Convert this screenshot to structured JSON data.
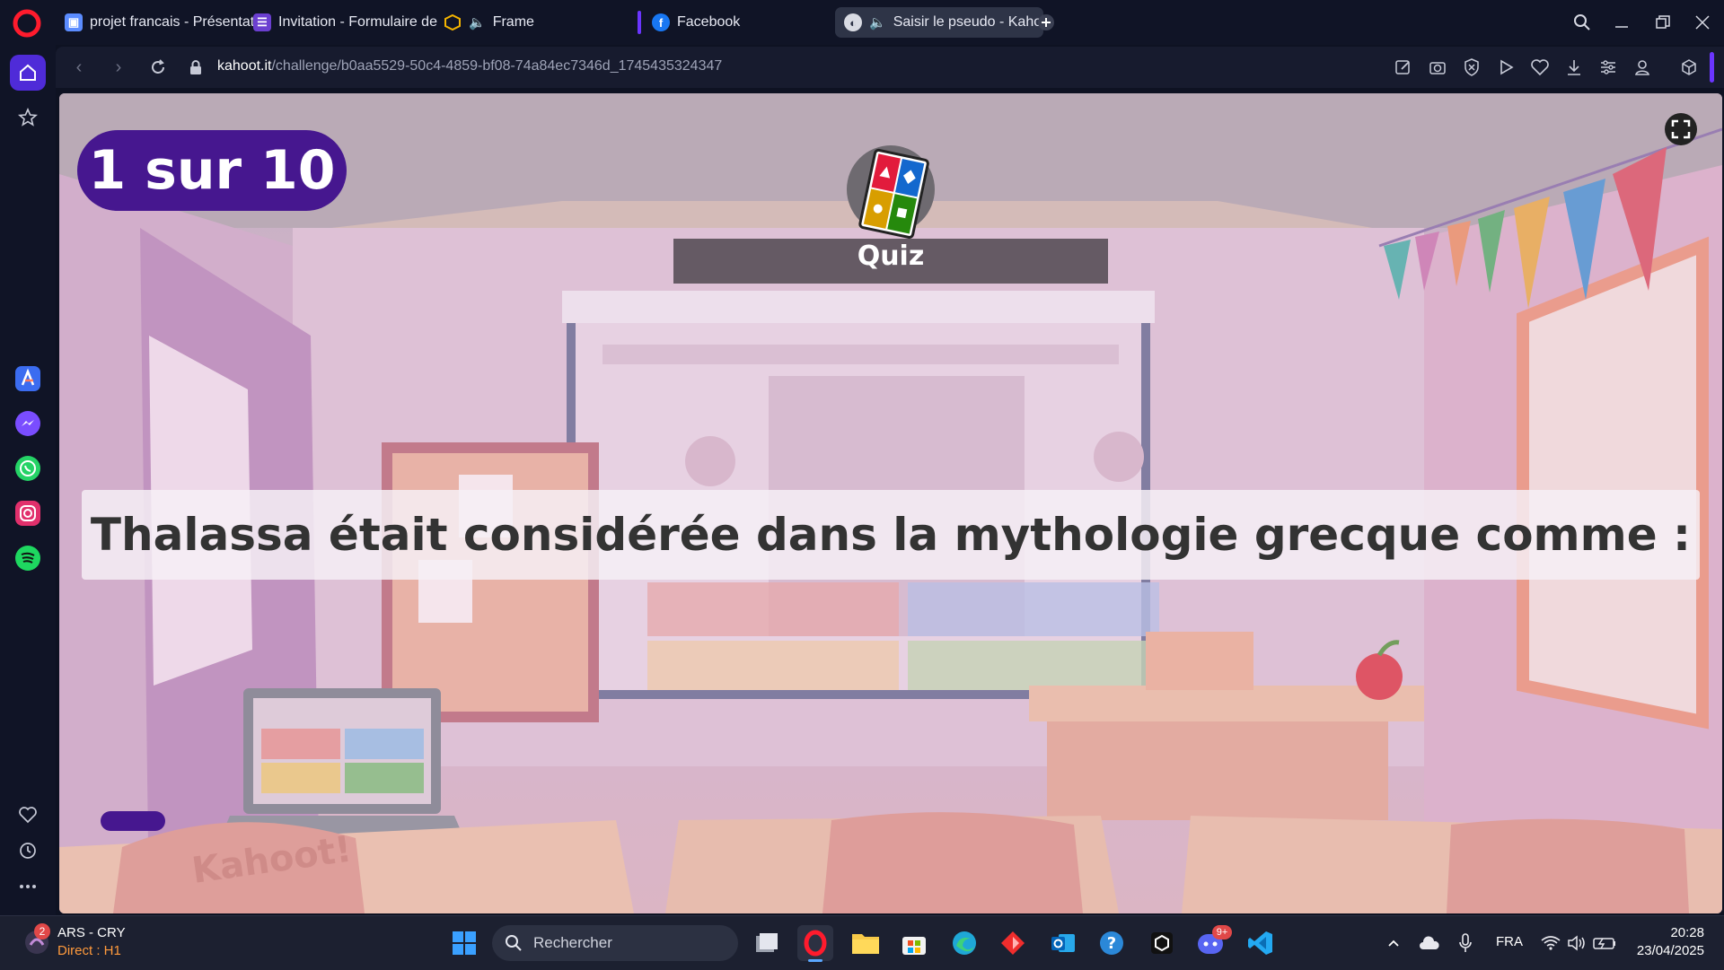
{
  "browser": {
    "tabs": [
      {
        "label": "projet francais - Présentati",
        "favicon": "slides-icon",
        "active": false
      },
      {
        "label": "Invitation - Formulaire de",
        "favicon": "form-icon",
        "active": false
      },
      {
        "label": "Frame",
        "favicon": "frame-icon",
        "active": false,
        "audio": true
      },
      {
        "label": "Facebook",
        "favicon": "facebook-icon",
        "active": false
      },
      {
        "label": "Saisir le pseudo - Kaho",
        "favicon": "globe-icon",
        "active": true,
        "audio": true
      }
    ],
    "url_host": "kahoot.it",
    "url_path": "/challenge/b0aa5529-50c4-4859-bf08-74a84ec7346d_1745435324347"
  },
  "game": {
    "counter": "1 sur 10",
    "badge": "Quiz",
    "question": "Thalassa était considérée dans la mythologie grecque comme :",
    "desk_text": "Kahoot!",
    "colors": {
      "purple": "#46178f",
      "red": "#e21b3c",
      "blue": "#1368ce",
      "yellow": "#d89e00",
      "green": "#26890c"
    }
  },
  "taskbar": {
    "media_title": "ARS - CRY",
    "media_subtitle": "Direct : H1",
    "media_badge": "2",
    "search_placeholder": "Rechercher",
    "discord_badge": "9+",
    "language": "FRA",
    "time": "20:28",
    "date": "23/04/2025"
  }
}
